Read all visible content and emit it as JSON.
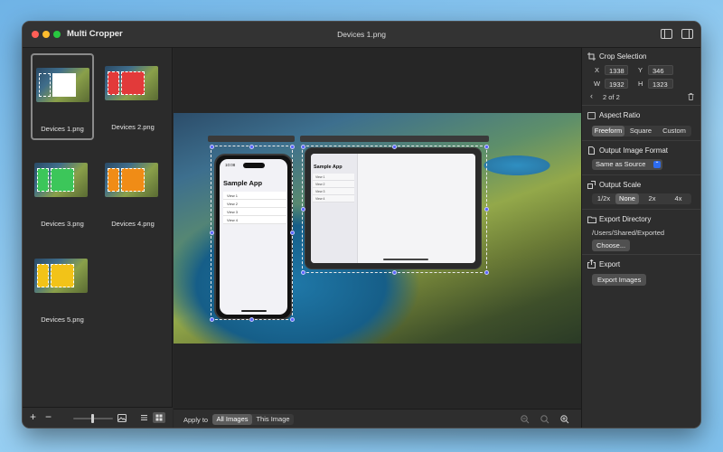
{
  "window": {
    "app_title": "Multi Cropper",
    "document_title": "Devices 1.png"
  },
  "colors": {
    "handle": "#5561ff",
    "accent": "#2d6cf1",
    "close": "#ff5f57",
    "minimize": "#febc2e",
    "zoom": "#28c840"
  },
  "icons": [
    "sidebar-toggle-icon",
    "inspector-toggle-icon",
    "crop-icon",
    "aspect-ratio-icon",
    "file-icon",
    "scale-icon",
    "folder-icon",
    "export-icon",
    "trash-icon"
  ],
  "thumbnails": [
    {
      "label": "Devices 1.png",
      "color": "#ffffff"
    },
    {
      "label": "Devices 2.png",
      "color": "#e23a3a"
    },
    {
      "label": "Devices 3.png",
      "color": "#3cc65a"
    },
    {
      "label": "Devices 4.png",
      "color": "#f08c16"
    },
    {
      "label": "Devices 5.png",
      "color": "#f2c318"
    }
  ],
  "sidebar_bottom": {
    "add": "+",
    "remove": "−"
  },
  "phone": {
    "time": "10:08",
    "title": "Sample App",
    "rows": [
      "View 1",
      "View 2",
      "View 3",
      "View 4"
    ]
  },
  "ipad": {
    "title": "Sample App",
    "rows": [
      "View 1",
      "View 2",
      "View 3",
      "View 4"
    ]
  },
  "crop_selection": {
    "title": "Crop Selection",
    "x_label": "X",
    "x": "1338",
    "y_label": "Y",
    "y": "346",
    "w_label": "W",
    "w": "1932",
    "h_label": "H",
    "h": "1323",
    "pager": "2 of 2"
  },
  "aspect_ratio": {
    "title": "Aspect Ratio",
    "options": [
      "Freeform",
      "Square",
      "Custom"
    ],
    "selected": "Freeform"
  },
  "output_format": {
    "title": "Output Image Format",
    "value": "Same as Source"
  },
  "output_scale": {
    "title": "Output Scale",
    "options": [
      "1/2x",
      "None",
      "2x",
      "4x"
    ],
    "selected": "None"
  },
  "export_directory": {
    "title": "Export Directory",
    "path": "/Users/Shared/Exported",
    "choose": "Choose..."
  },
  "export": {
    "title": "Export",
    "button": "Export Images"
  },
  "canvas_bar": {
    "apply_to": "Apply to",
    "options": [
      "All Images",
      "This Image"
    ],
    "selected": "All Images"
  }
}
